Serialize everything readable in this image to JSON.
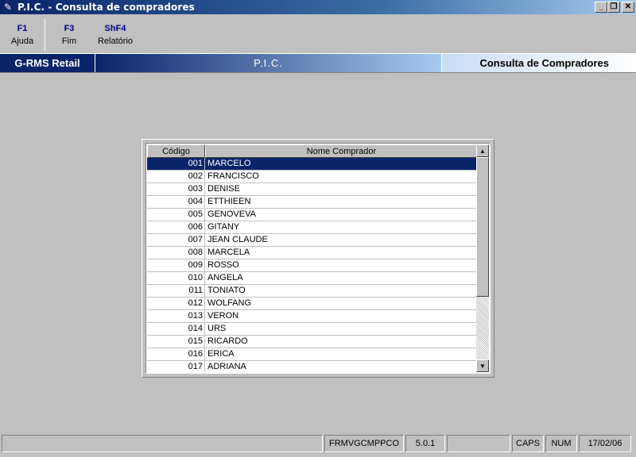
{
  "window": {
    "title": "P.I.C. - Consulta de compradores",
    "minimize_glyph": "_",
    "restore_glyph": "❐",
    "close_glyph": "✕"
  },
  "toolbar": {
    "keys": [
      {
        "key": "F1",
        "label": "Ajuda"
      },
      {
        "key": "F3",
        "label": "Fim"
      },
      {
        "key": "ShF4",
        "label": "Relatório"
      }
    ]
  },
  "header": {
    "left": "G-RMS Retail",
    "center": "P.I.C.",
    "right": "Consulta de Compradores"
  },
  "grid": {
    "columns": [
      "Código",
      "Nome Comprador"
    ],
    "selected_index": 0,
    "rows": [
      {
        "code": "001",
        "name": "MARCELO"
      },
      {
        "code": "002",
        "name": "FRANCISCO"
      },
      {
        "code": "003",
        "name": "DENISE"
      },
      {
        "code": "004",
        "name": "ETTHIEEN"
      },
      {
        "code": "005",
        "name": "GENOVEVA"
      },
      {
        "code": "006",
        "name": "GITANY"
      },
      {
        "code": "007",
        "name": "JEAN CLAUDE"
      },
      {
        "code": "008",
        "name": "MARCELA"
      },
      {
        "code": "009",
        "name": "ROSSO"
      },
      {
        "code": "010",
        "name": "ANGELA"
      },
      {
        "code": "011",
        "name": "TONIATO"
      },
      {
        "code": "012",
        "name": "WOLFANG"
      },
      {
        "code": "013",
        "name": "VERON"
      },
      {
        "code": "014",
        "name": "URS"
      },
      {
        "code": "015",
        "name": "RICARDO"
      },
      {
        "code": "016",
        "name": "ERICA"
      },
      {
        "code": "017",
        "name": "ADRIANA"
      }
    ]
  },
  "statusbar": {
    "panels": [
      "",
      "FRMVGCMPPCO",
      "5.0.1",
      "",
      "CAPS",
      "NUM",
      "17/02/06"
    ]
  },
  "colors": {
    "selection": "#0a246a",
    "title_bar": "#0a246a",
    "face": "#c0c0c0"
  }
}
